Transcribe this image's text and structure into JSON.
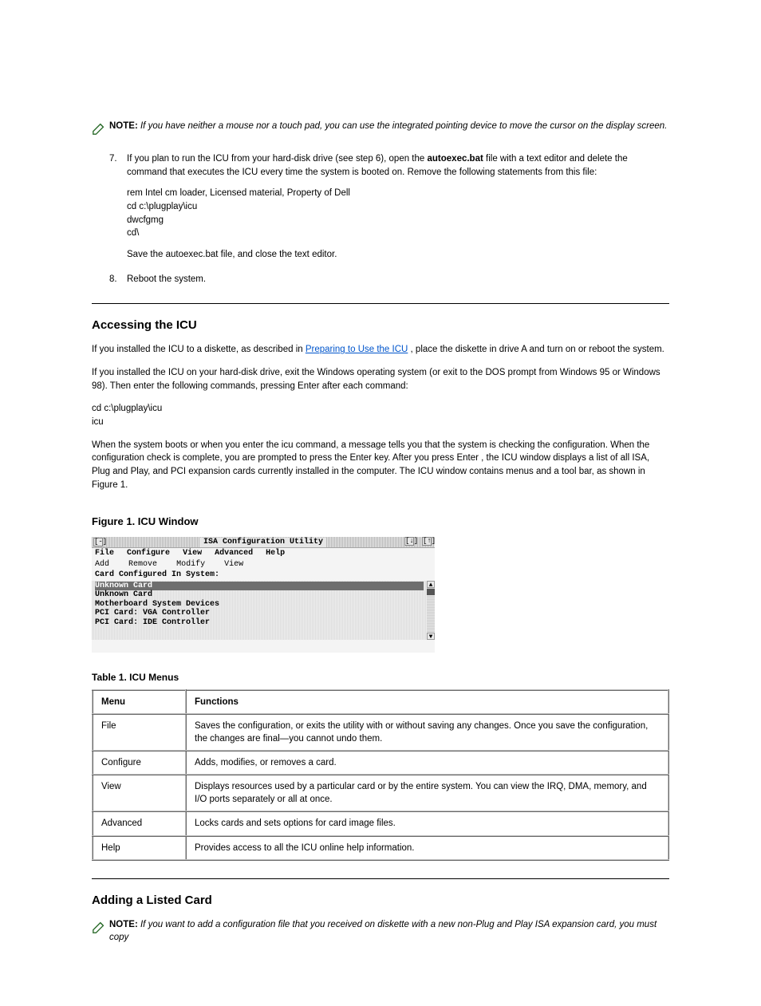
{
  "note": {
    "label": "NOTE:",
    "text": "If you have neither a mouse nor a touch pad, you can use the integrated pointing device to move the cursor on the display screen."
  },
  "steps": [
    {
      "num": "7.",
      "body": "If you plan to run the ICU from your hard-disk drive (see step 6), open the",
      "body_tail": "Remove the following statements from this file:",
      "file": "autoexec.bat",
      "editor": " file with a text editor and delete the command that executes the ICU every time the system is booted on.",
      "codeblock": [
        "rem Intel cm loader, Licensed material, Property of Dell",
        "cd c:\\plugplay\\icu",
        "dwcfgmg",
        "cd\\"
      ],
      "after": "Save the autoexec.bat file, and close the text editor."
    },
    {
      "num": "8.",
      "body": "Reboot the system."
    }
  ],
  "accessing": {
    "heading": "Accessing the ICU",
    "para1_pre": "If you installed the ICU to a diskette, as described in ",
    "para1_link": "Preparing to Use the ICU",
    "para1_post": ", place the diskette in drive A and turn on or reboot the system.",
    "para2": "If you installed the ICU on your hard-disk drive, exit the Windows operating system (or exit to the DOS prompt from Windows 95 or Windows 98). Then enter the following commands, pressing Enter after each command:",
    "cmds": [
      "cd c:\\plugplay\\icu",
      "icu"
    ],
    "para3_pre": "When the system boots or when you enter the ",
    "para3_cmd": "icu",
    "para3_mid": " command, a message tells you that the system is checking the configuration. When the configuration check is complete, you are prompted to press the Enter key. After you press ",
    "para3_enter": "Enter",
    "para3_post": ", the ICU window displays a list of all ISA, Plug and Play, and PCI expansion cards currently installed in the computer. The ICU window contains menus and a tool bar, as shown in Figure 1."
  },
  "figure": {
    "caption": "Figure 1. ICU Window",
    "title": "ISA Configuration Utility",
    "close": "[-]",
    "up": "[↑]",
    "down": "[↓]",
    "menubar": [
      "File",
      "Configure",
      "View",
      "Advanced",
      "Help"
    ],
    "toolbar": [
      "Add",
      "Remove",
      "Modify",
      "View"
    ],
    "section_label": "Card Configured In System:",
    "rows": [
      "Unknown Card",
      "Unknown Card",
      "Motherboard System Devices",
      "PCI Card: VGA Controller",
      "PCI Card: IDE Controller"
    ]
  },
  "table": {
    "caption": "Table 1. ICU Menus",
    "headers": [
      "Menu",
      "Functions"
    ],
    "rows": [
      [
        "File",
        "Saves the configuration, or exits the utility with or without saving any changes. Once you save the configuration, the changes are final—you cannot undo them."
      ],
      [
        "Configure",
        "Adds, modifies, or removes a card."
      ],
      [
        "View",
        "Displays resources used by a particular card or by the entire system. You can view the IRQ, DMA, memory, and I/O ports separately or all at once."
      ],
      [
        "Advanced",
        "Locks cards and sets options for card image files."
      ],
      [
        "Help",
        "Provides access to all the ICU online help information."
      ]
    ]
  },
  "adding": {
    "heading": "Adding a Listed Card",
    "note_label": "NOTE:",
    "note_text": "If you want to add a configuration file that you received on diskette with a new non-Plug and Play ISA expansion card, you must copy"
  }
}
